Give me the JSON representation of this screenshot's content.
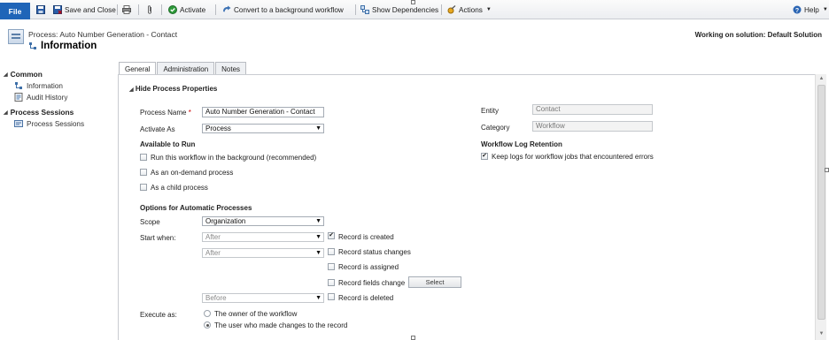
{
  "ribbon": {
    "file": "File",
    "save_close": "Save and Close",
    "activate": "Activate",
    "convert": "Convert to a background workflow",
    "show_dependencies": "Show Dependencies",
    "actions": "Actions",
    "help": "Help"
  },
  "header": {
    "subtitle": "Process: Auto Number Generation - Contact",
    "title": "Information",
    "solution": "Working on solution: Default Solution"
  },
  "nav": {
    "common": "Common",
    "information": "Information",
    "audit_history": "Audit History",
    "process_sessions_header": "Process Sessions",
    "process_sessions": "Process Sessions"
  },
  "tabs": [
    "General",
    "Administration",
    "Notes"
  ],
  "section": {
    "hide_props": "Hide Process Properties"
  },
  "form": {
    "process_name_label": "Process Name",
    "required_mark": "*",
    "process_name_value": "Auto Number Generation - Contact",
    "activate_as_label": "Activate As",
    "activate_as_value": "Process",
    "available_header": "Available to Run",
    "opt_background": "Run this workflow in the background (recommended)",
    "opt_on_demand": "As an on-demand process",
    "opt_child": "As a child process",
    "entity_label": "Entity",
    "entity_value": "Contact",
    "category_label": "Category",
    "category_value": "Workflow",
    "log_header": "Workflow Log Retention",
    "log_option": "Keep logs for workflow jobs that encountered errors",
    "auto_header": "Options for Automatic Processes",
    "scope_label": "Scope",
    "scope_value": "Organization",
    "start_when_label": "Start when:",
    "after1": "After",
    "after2": "After",
    "before": "Before",
    "record_created": "Record is created",
    "record_status": "Record status changes",
    "record_assigned": "Record is assigned",
    "record_fields": "Record fields change",
    "select_button": "Select",
    "record_deleted": "Record is deleted",
    "execute_as_label": "Execute as:",
    "exec_owner": "The owner of the workflow",
    "exec_user": "The user who made changes to the record"
  },
  "state": {
    "record_created_checked": true,
    "log_checked": true,
    "exec_as_selected": "user"
  },
  "colors": {
    "file_button": "#1f65b8",
    "required": "#cc0000"
  }
}
